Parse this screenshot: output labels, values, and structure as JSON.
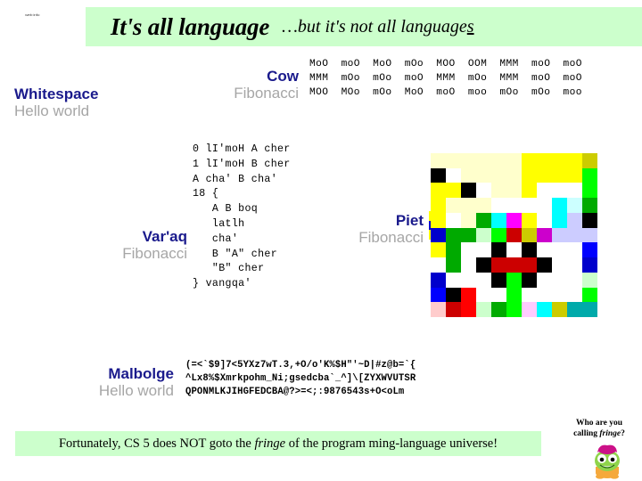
{
  "slide": {
    "corner_mark": "web info",
    "title": {
      "main": "It's all language",
      "sub_pre": "…but it's not all language",
      "sub_underlined": "s"
    },
    "bottom_banner": {
      "pre": "Fortunately, CS 5 does NOT goto the ",
      "emphasis": "fringe",
      "post": " of the program ming-language universe!"
    },
    "mascot": {
      "caption_line1": "Who are you",
      "caption_line2_pre": "calling ",
      "caption_line2_emphasis": "fringe",
      "caption_line2_post": "?",
      "icon": "mascot-fringe-icon"
    }
  },
  "languages": [
    {
      "name": "Whitespace",
      "program": "Hello world",
      "code": ""
    },
    {
      "name": "Cow",
      "program": "Fibonacci",
      "code": "MoO  moO  MoO  mOo  MOO  OOM  MMM  moO  moO\nMMM  mOo  mOo  moO  MMM  mOo  MMM  moO  moO\nMOO  MOo  mOo  MoO  moO  moo  mOo  mOo  moo"
    },
    {
      "name": "Var'aq",
      "program": "Fibonacci",
      "code": "0 lI'moH A cher\n1 lI'moH B cher\nA cha' B cha'\n18 {\n   A B boq\n   latlh\n   cha'\n   B \"A\" cher\n   \"B\" cher\n} vangqa'"
    },
    {
      "name": "Piet",
      "program": "Fibonacci",
      "code": ""
    },
    {
      "name": "Malbolge",
      "program": "Hello world",
      "code": "(=<`$9]7<5YXz7wT.3,+O/o'K%$H\"'~D|#z@b=`{\n^Lx8%$Xmrkpohm_Ni;gsedcba`_^]\\[ZYXWVUTSR\nQPONMLKJIHGFEDCBA@?>=<;:9876543s+O<oLm"
    }
  ],
  "colors": {
    "banner_green": "#ccffcc",
    "lang_name_navy": "#1a1a8c",
    "lang_prog_gray": "#a6a6a6",
    "code_black": "#000000"
  },
  "piet_grid": {
    "cols": 12,
    "rows": 11,
    "cells": [
      [
        "#ffffcc",
        "#ffffcc",
        "#ffffcc",
        "#ffffcc",
        "#ffffcc",
        "#ffffcc",
        "#ffff00",
        "#ffff00",
        "#ffff00",
        "#ffff00",
        "#cccc00",
        "#ffffff"
      ],
      [
        "#000000",
        "#ffffff",
        "#ffffcc",
        "#ffffcc",
        "#ffffcc",
        "#ffffcc",
        "#ffff00",
        "#ffff00",
        "#ffff00",
        "#ffff00",
        "#00ff00",
        "#ffffff"
      ],
      [
        "#ffff00",
        "#ffff00",
        "#000000",
        "#ffffff",
        "#ffffcc",
        "#ffffcc",
        "#ffff00",
        "#ffffff",
        "#ffffff",
        "#ffffff",
        "#00ff00",
        "#ffffff"
      ],
      [
        "#ffff00",
        "#ffffcc",
        "#ffffcc",
        "#ffffcc",
        "#ffffff",
        "#ffffff",
        "#ffffff",
        "#ffffff",
        "#00ffff",
        "#ccffff",
        "#00aa00",
        "#ffffff"
      ],
      [
        "#ffff00",
        "#ffffff",
        "#ffffcc",
        "#00aa00",
        "#00ffff",
        "#ff00ff",
        "#ffff00",
        "#ffffff",
        "#00ffff",
        "#ccccff",
        "#000000",
        "#ffffff"
      ],
      [
        "#0000cc",
        "#00aa00",
        "#00aa00",
        "#ccffcc",
        "#00ff00",
        "#cc0000",
        "#cccc00",
        "#cc00cc",
        "#ccccff",
        "#ccccff",
        "#ccccff",
        "#ffffff"
      ],
      [
        "#ffff00",
        "#00aa00",
        "#ffffff",
        "#ffffff",
        "#000000",
        "#ffffff",
        "#000000",
        "#ffffff",
        "#ffffff",
        "#ffffff",
        "#0000ff",
        "#ffffff"
      ],
      [
        "#ffffff",
        "#00aa00",
        "#ffffff",
        "#000000",
        "#cc0000",
        "#cc0000",
        "#cc0000",
        "#000000",
        "#ffffff",
        "#ffffff",
        "#0000cc",
        "#ffffff"
      ],
      [
        "#0000cc",
        "#ffffff",
        "#ffffff",
        "#ffffff",
        "#000000",
        "#00ff00",
        "#000000",
        "#ffffff",
        "#ffffff",
        "#ffffff",
        "#ccffcc",
        "#ffffff"
      ],
      [
        "#0000ff",
        "#000000",
        "#ff0000",
        "#ffffff",
        "#ffffff",
        "#00ff00",
        "#ffffff",
        "#ffffff",
        "#ffffff",
        "#ffffff",
        "#00ff00",
        "#ffffff"
      ],
      [
        "#ffcccc",
        "#cc0000",
        "#ff0000",
        "#ccffcc",
        "#00aa00",
        "#00ff00",
        "#ffccff",
        "#00ffff",
        "#cccc00",
        "#00aaaa",
        "#00aaaa",
        "#ffffff"
      ]
    ]
  },
  "piet_thumb": {
    "cols": 2,
    "rows": 3,
    "cells": [
      [
        "#ffff00",
        "#ffffff"
      ],
      [
        "#0000cc",
        "#00aa00"
      ],
      [
        "#ffff00",
        "#00aa00"
      ]
    ]
  }
}
